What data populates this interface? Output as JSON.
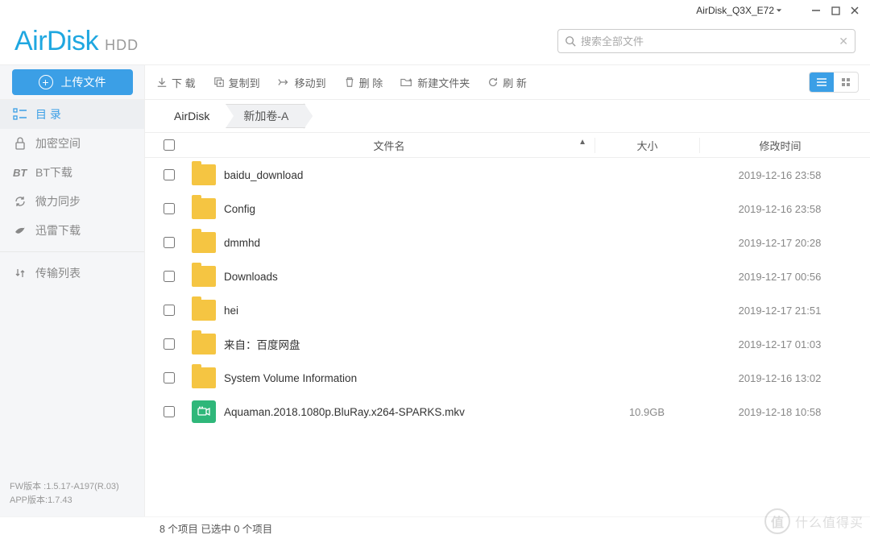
{
  "window": {
    "device_name": "AirDisk_Q3X_E72"
  },
  "logo": {
    "main": "AirDisk",
    "sub": "HDD"
  },
  "search": {
    "placeholder": "搜索全部文件"
  },
  "upload_button": "上传文件",
  "toolbar": {
    "download": "下 载",
    "copy_to": "复制到",
    "move_to": "移动到",
    "delete": "删 除",
    "new_folder": "新建文件夹",
    "refresh": "刷 新"
  },
  "sidebar": {
    "items": [
      {
        "label": "目 录",
        "icon": "list"
      },
      {
        "label": "加密空间",
        "icon": "lock"
      },
      {
        "label": "BT下载",
        "icon": "bt"
      },
      {
        "label": "微力同步",
        "icon": "sync"
      },
      {
        "label": "迅雷下载",
        "icon": "bird"
      }
    ],
    "transfer": "传输列表",
    "fw_version": "FW版本 :1.5.17-A197(R.03)",
    "app_version": "APP版本:1.7.43"
  },
  "breadcrumb": [
    "AirDisk",
    "新加卷-A"
  ],
  "columns": {
    "name": "文件名",
    "size": "大小",
    "time": "修改时间"
  },
  "files": [
    {
      "type": "folder",
      "name": "baidu_download",
      "size": "",
      "time": "2019-12-16 23:58"
    },
    {
      "type": "folder",
      "name": "Config",
      "size": "",
      "time": "2019-12-16 23:58"
    },
    {
      "type": "folder",
      "name": "dmmhd",
      "size": "",
      "time": "2019-12-17 20:28"
    },
    {
      "type": "folder",
      "name": "Downloads",
      "size": "",
      "time": "2019-12-17 00:56"
    },
    {
      "type": "folder",
      "name": "hei",
      "size": "",
      "time": "2019-12-17 21:51"
    },
    {
      "type": "folder",
      "name": "来自：百度网盘",
      "size": "",
      "time": "2019-12-17 01:03"
    },
    {
      "type": "folder",
      "name": "System Volume Information",
      "size": "",
      "time": "2019-12-16 13:02"
    },
    {
      "type": "video",
      "name": "Aquaman.2018.1080p.BluRay.x264-SPARKS.mkv",
      "size": "10.9GB",
      "time": "2019-12-18 10:58"
    }
  ],
  "status": "8 个项目 已选中 0 个项目",
  "watermark": "什么值得买"
}
